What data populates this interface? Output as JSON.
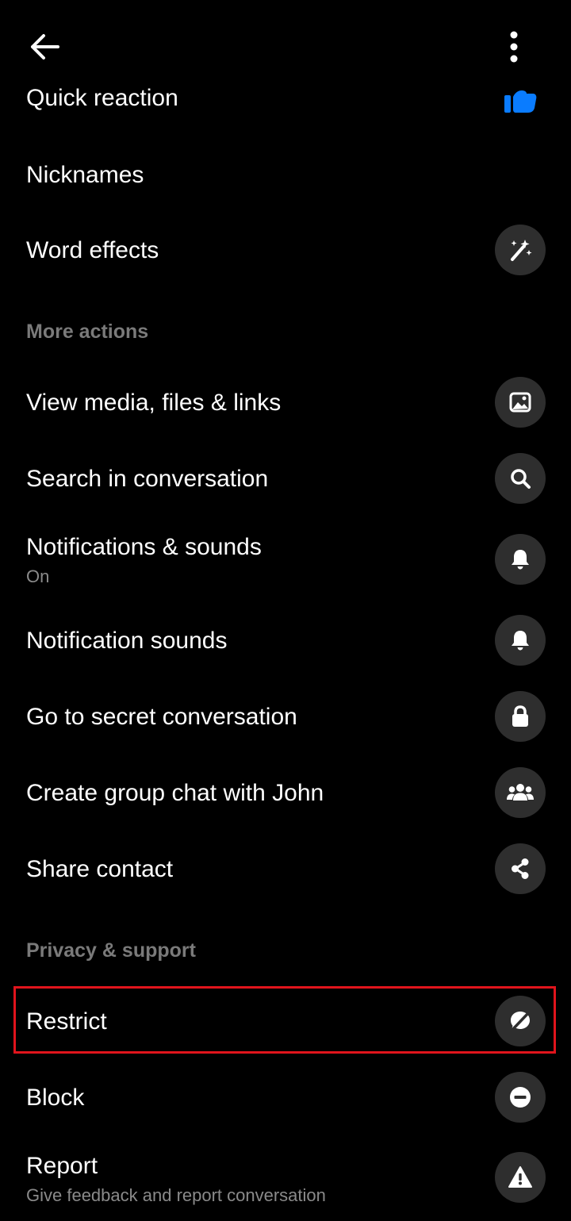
{
  "header": {
    "back_icon": "arrow-left-icon",
    "more_icon": "vertical-dots-icon"
  },
  "items": {
    "quick_reaction": {
      "label": "Quick reaction",
      "icon": "thumbs-up-icon",
      "icon_color": "#0a7cff"
    },
    "nicknames": {
      "label": "Nicknames"
    },
    "word_effects": {
      "label": "Word effects",
      "icon": "magic-wand-icon"
    },
    "more_actions_header": "More actions",
    "view_media": {
      "label": "View media, files & links",
      "icon": "image-icon"
    },
    "search": {
      "label": "Search in conversation",
      "icon": "search-icon"
    },
    "notifications": {
      "label": "Notifications & sounds",
      "sublabel": "On",
      "icon": "bell-icon"
    },
    "notification_sounds": {
      "label": "Notification sounds",
      "icon": "bell-icon"
    },
    "secret": {
      "label": "Go to secret conversation",
      "icon": "lock-icon"
    },
    "group_chat": {
      "label": "Create group chat with John",
      "icon": "group-icon"
    },
    "share_contact": {
      "label": "Share contact",
      "icon": "share-icon"
    },
    "privacy_header": "Privacy & support",
    "restrict": {
      "label": "Restrict",
      "icon": "restrict-icon",
      "highlighted": true
    },
    "block": {
      "label": "Block",
      "icon": "block-icon"
    },
    "report": {
      "label": "Report",
      "sublabel": "Give feedback and report conversation",
      "icon": "warning-icon"
    }
  },
  "colors": {
    "background": "#000000",
    "icon_circle": "#2e2e2e",
    "highlight": "#e0141c",
    "section_text": "#7a7a7a",
    "accent": "#0a7cff"
  }
}
